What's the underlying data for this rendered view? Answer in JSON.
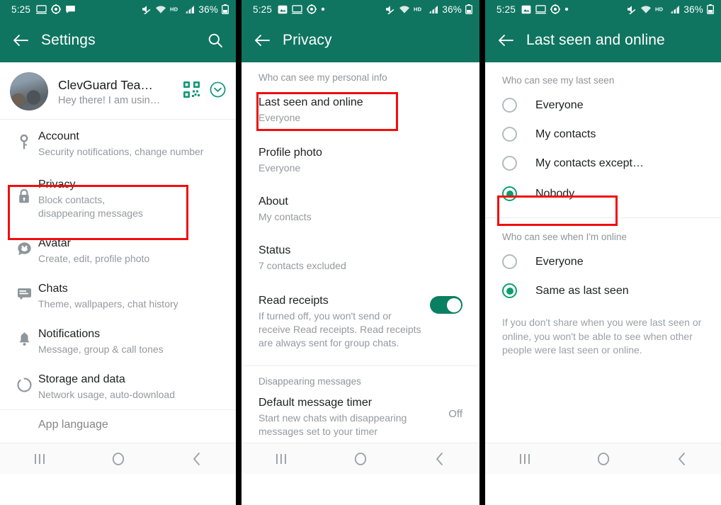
{
  "colors": {
    "header_green": "#0f7560",
    "accent_green": "#0a9e72",
    "toggle_green": "#0a8062",
    "highlight_red": "#f20d0d",
    "text_primary": "#1d1f20",
    "text_secondary": "#939a9e"
  },
  "statusbar": {
    "time": "5:25",
    "battery": "36%",
    "icons_left_p1": [
      "screen-icon",
      "gear-icon",
      "chat-bubble-icon"
    ],
    "icons_left_p2": [
      "picture-icon",
      "screen-icon",
      "gear-icon",
      "dot-icon"
    ],
    "icons_right": [
      "mute-icon",
      "wifi-icon",
      "hd-icon",
      "signal-icon"
    ],
    "hd_label": "HD"
  },
  "navbar": {
    "recents": "recents-button",
    "home": "home-button",
    "back": "back-button"
  },
  "panel1": {
    "title": "Settings",
    "search_icon": "search-icon",
    "profile": {
      "name": "ClevGuard Tea…",
      "status": "Hey there! I am usin…",
      "qr_icon": "qr-code-icon",
      "expand_icon": "chevron-down-circle-icon"
    },
    "items": [
      {
        "icon": "key-icon",
        "title": "Account",
        "subtitle": "Security notifications, change number",
        "highlighted": false
      },
      {
        "icon": "lock-icon",
        "title": "Privacy",
        "subtitle": "Block contacts, disappearing messages",
        "highlighted": true
      },
      {
        "icon": "avatar-icon",
        "title": "Avatar",
        "subtitle": "Create, edit, profile photo",
        "highlighted": false
      },
      {
        "icon": "chats-icon",
        "title": "Chats",
        "subtitle": "Theme, wallpapers, chat history",
        "highlighted": false
      },
      {
        "icon": "bell-icon",
        "title": "Notifications",
        "subtitle": "Message, group & call tones",
        "highlighted": false
      },
      {
        "icon": "storage-icon",
        "title": "Storage and data",
        "subtitle": "Network usage, auto-download",
        "highlighted": false
      },
      {
        "icon": "language-icon",
        "title": "App language",
        "subtitle": "",
        "highlighted": false
      }
    ]
  },
  "panel2": {
    "title": "Privacy",
    "section1_label": "Who can see my personal info",
    "rows": [
      {
        "title": "Last seen and online",
        "value": "Everyone",
        "highlighted": true
      },
      {
        "title": "Profile photo",
        "value": "Everyone",
        "highlighted": false
      },
      {
        "title": "About",
        "value": "My contacts",
        "highlighted": false
      },
      {
        "title": "Status",
        "value": "7 contacts excluded",
        "highlighted": false
      }
    ],
    "read_receipts": {
      "title": "Read receipts",
      "description": "If turned off, you won't send or receive Read receipts. Read receipts are always sent for group chats.",
      "toggle_on": true
    },
    "section2_label": "Disappearing messages",
    "timer": {
      "title": "Default message timer",
      "description": "Start new chats with disappearing messages set to your timer",
      "value": "Off"
    }
  },
  "panel3": {
    "title": "Last seen and online",
    "group1_label": "Who can see my last seen",
    "group1_options": [
      {
        "label": "Everyone",
        "selected": false,
        "highlighted": false
      },
      {
        "label": "My contacts",
        "selected": false,
        "highlighted": false
      },
      {
        "label": "My contacts except…",
        "selected": false,
        "highlighted": false
      },
      {
        "label": "Nobody",
        "selected": true,
        "highlighted": true
      }
    ],
    "group2_label": "Who can see when I'm online",
    "group2_options": [
      {
        "label": "Everyone",
        "selected": false,
        "highlighted": false
      },
      {
        "label": "Same as last seen",
        "selected": true,
        "highlighted": false
      }
    ],
    "footer_note": "If you don't share when you were last seen or online, you won't be able to see when other people were last seen or online."
  }
}
